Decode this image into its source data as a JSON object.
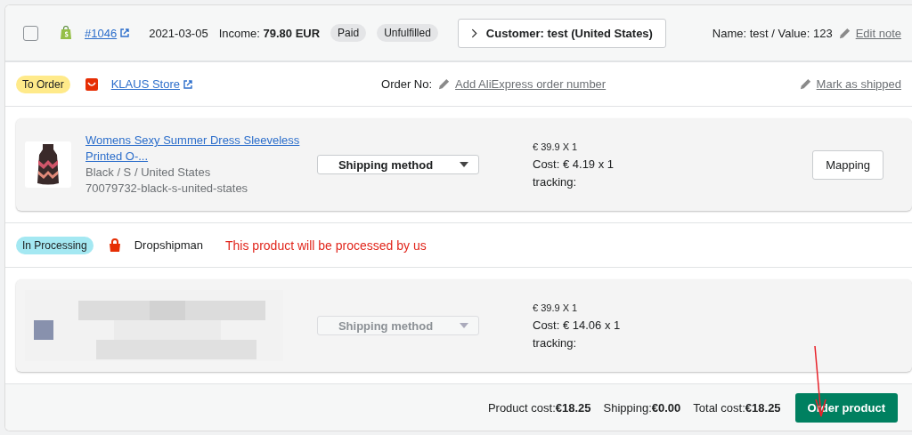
{
  "order": {
    "checked": false,
    "number": "#1046",
    "date": "2021-03-05",
    "income": "Income: **79.80 EUR**",
    "badges": [
      "Paid",
      "Unfulfilled"
    ],
    "customer_button": "Customer: test (United States)",
    "note": "Name: test / Value: 123",
    "edit_note": "Edit note"
  },
  "groups": [
    {
      "kind": "aliexpress",
      "status": "To Order",
      "color": "#ffea8a",
      "store": "KLAUS Store",
      "order_no_label": "Order No:",
      "order_no_link": "Add AliExpress order number",
      "mark_shipped": "Mark as shipped",
      "products": [
        {
          "kind": "dress",
          "title_line1": "Womens Sexy Summer Dress Sleeveless",
          "title_line2": "Printed O-...",
          "variant": "Black / S / United States",
          "sku": "70079732-black-s-united-states",
          "shipping": "Shipping method",
          "disabled": false,
          "price": "€ 39.9 X 1",
          "cost": "Cost: € 4.19 x 1",
          "tracking": "tracking:",
          "mapping": "Mapping"
        }
      ]
    },
    {
      "kind": "dropshipman",
      "status": "In Processing",
      "color": "#a4e8f2",
      "store": "Dropshipman",
      "message": "This product will be processed by us",
      "products": [
        {
          "kind": "picture",
          "shipping": "Shipping method",
          "disabled": true,
          "price": "€ 39.9 X 1",
          "cost": "Cost: € 14.06 x 1",
          "tracking": "tracking:"
        }
      ]
    }
  ],
  "totals": [
    "Product cost:**€18.25**",
    "Shipping:**€0.00**",
    "Total cost:**€18.25**"
  ],
  "order_button": "Order product"
}
